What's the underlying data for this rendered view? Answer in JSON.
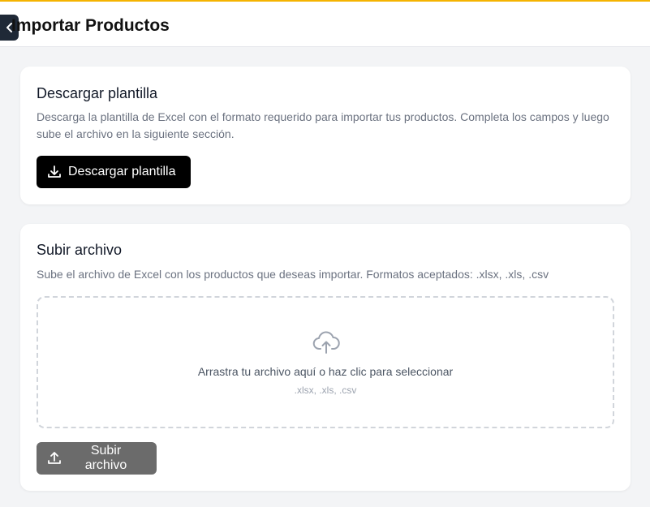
{
  "header": {
    "title": "Importar Productos",
    "back_icon": "chevron-left-icon"
  },
  "download_section": {
    "title": "Descargar plantilla",
    "description": "Descarga la plantilla de Excel con el formato requerido para importar tus productos. Completa los campos y luego sube el archivo en la siguiente sección.",
    "button_label": "Descargar plantilla",
    "button_icon": "download-icon"
  },
  "upload_section": {
    "title": "Subir archivo",
    "description": "Sube el archivo de Excel con los productos que deseas importar. Formatos aceptados: .xlsx, .xls, .csv",
    "dropzone": {
      "icon": "cloud-upload-icon",
      "text": "Arrastra tu archivo aquí o haz clic para seleccionar",
      "hint": ".xlsx, .xls, .csv"
    },
    "button_label": "Subir archivo",
    "button_icon": "upload-icon"
  },
  "colors": {
    "accent_top_border": "#f5b301",
    "primary_button": "#000000",
    "disabled_button": "#6b6b6b",
    "background": "#f3f4f6"
  }
}
